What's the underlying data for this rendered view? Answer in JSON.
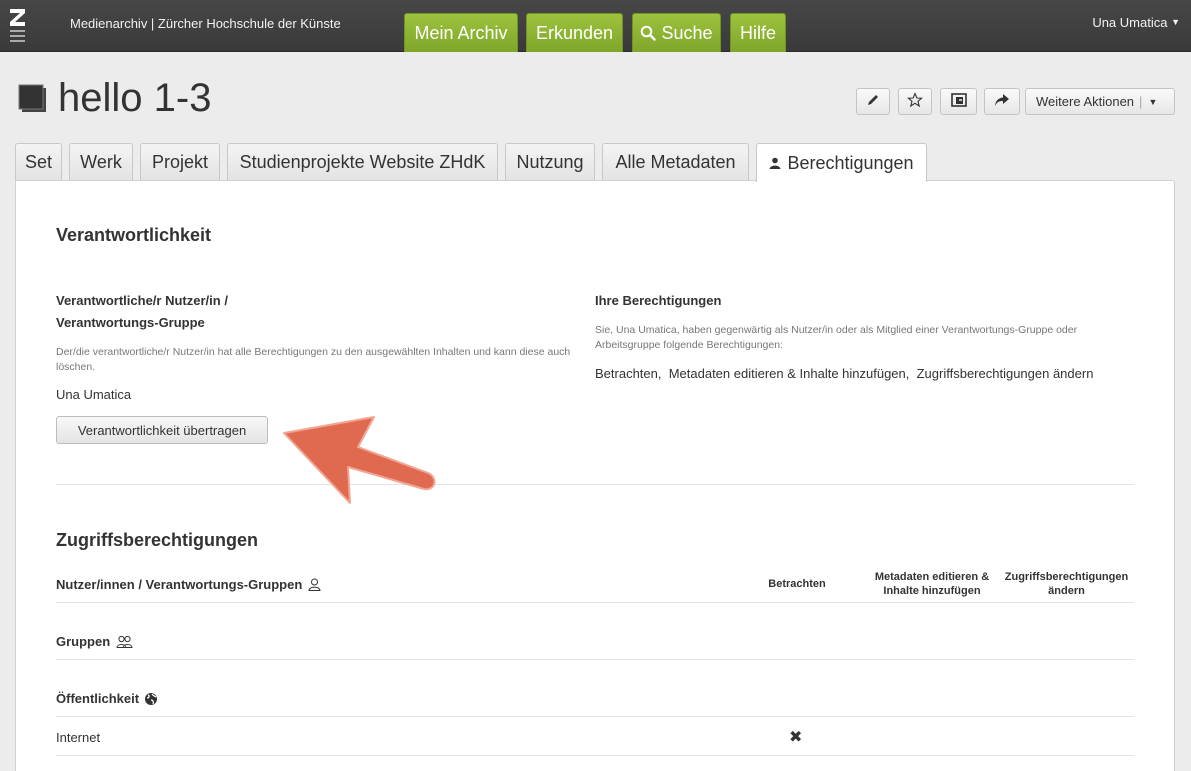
{
  "topbar": {
    "brand": "Medienarchiv | Zürcher Hochschule der Künste",
    "nav": [
      {
        "label": "Mein Archiv"
      },
      {
        "label": "Erkunden"
      },
      {
        "label": "Suche",
        "icon": "search-icon"
      },
      {
        "label": "Hilfe"
      }
    ],
    "user": "Una Umatica"
  },
  "header": {
    "title": "hello 1-3",
    "more_actions": "Weitere Aktionen",
    "tools": [
      "pencil-icon",
      "star-icon",
      "move-icon",
      "share-icon"
    ]
  },
  "tabs": [
    {
      "label": "Set"
    },
    {
      "label": "Werk"
    },
    {
      "label": "Projekt"
    },
    {
      "label": "Studienprojekte Website ZHdK"
    },
    {
      "label": "Nutzung"
    },
    {
      "label": "Alle Metadaten"
    },
    {
      "label": "Berechtigungen",
      "icon": "user-icon",
      "active": true
    }
  ],
  "responsibility": {
    "heading": "Verantwortlichkeit",
    "owner_label_1": "Verantwortliche/r Nutzer/in /",
    "owner_label_2": "Verantwortungs-Gruppe",
    "owner_hint": "Der/die verantwortliche/r Nutzer/in hat alle Berechtigungen zu den ausgewählten Inhalten und kann diese auch löschen.",
    "owner_name": "Una Umatica",
    "transfer_button": "Verantwortlichkeit übertragen",
    "your_perms_heading": "Ihre Berechtigungen",
    "your_perms_hint": "Sie, Una Umatica, haben gegenwärtig als Nutzer/in oder als Mitglied einer Verantwortungs-Gruppe oder Arbeitsgruppe folgende Berechtigungen:",
    "your_perms": "Betrachten,  Metadaten editieren & Inhalte hinzufügen,  Zugriffsberechtigungen ändern"
  },
  "access": {
    "heading": "Zugriffsberechtigungen",
    "users_label": "Nutzer/innen / Verantwortungs-Gruppen",
    "col_view": "Betrachten",
    "col_edit_1": "Metadaten editieren &",
    "col_edit_2": "Inhalte hinzufügen",
    "col_perms_1": "Zugriffsberechtigungen",
    "col_perms_2": "ändern",
    "groups_label": "Gruppen",
    "public_label": "Öffentlichkeit",
    "internet_label": "Internet",
    "internet_view_mark": "✖"
  },
  "annotation": {
    "arrow_color": "#e06a4f"
  }
}
